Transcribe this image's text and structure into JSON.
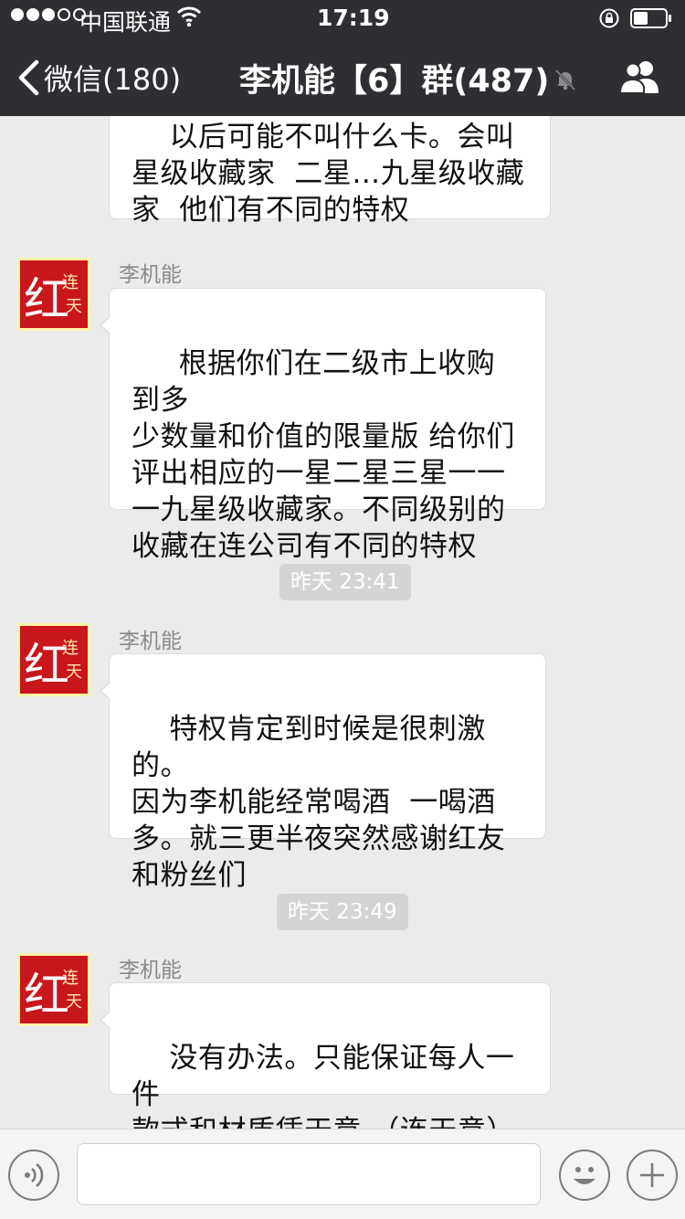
{
  "status_bar": {
    "carrier": "中国联通",
    "time": "17:19",
    "signal_bars_filled": 3,
    "signal_bars_total": 5,
    "icons": [
      "wifi-icon",
      "rotation-lock-icon",
      "battery-icon"
    ]
  },
  "nav": {
    "back_label": "微信(180)",
    "title": "李机能【6】群(487)",
    "icons": [
      "chevron-left-icon",
      "mute-bell-icon",
      "group-members-icon"
    ]
  },
  "messages": [
    {
      "kind": "text",
      "sender": "",
      "text": "以后可能不叫什么卡。会叫\n星级收藏家  二星…九星级收藏\n家  他们有不同的特权"
    },
    {
      "kind": "text",
      "sender": "李机能",
      "text": " 根据你们在二级市上收购到多\n少数量和价值的限量版 给你们\n评出相应的一星二星三星一一\n一九星级收藏家。不同级别的\n收藏在连公司有不同的特权"
    },
    {
      "kind": "time",
      "text": "昨天 23:41"
    },
    {
      "kind": "text",
      "sender": "李机能",
      "text": "特权肯定到时候是很刺激的。\n因为李机能经常喝酒  一喝酒\n多。就三更半夜突然感谢红友\n和粉丝们"
    },
    {
      "kind": "time",
      "text": "昨天 23:49"
    },
    {
      "kind": "text",
      "sender": "李机能",
      "text": "没有办法。只能保证每人一件\n款式和材质凭天意 （连天意）"
    }
  ],
  "avatar": {
    "glyph": "红",
    "small_glyphs": "连天",
    "color": "#c8161d"
  },
  "input_bar": {
    "text_value": "",
    "icons": [
      "voice-icon",
      "emoji-icon",
      "plus-icon"
    ]
  }
}
